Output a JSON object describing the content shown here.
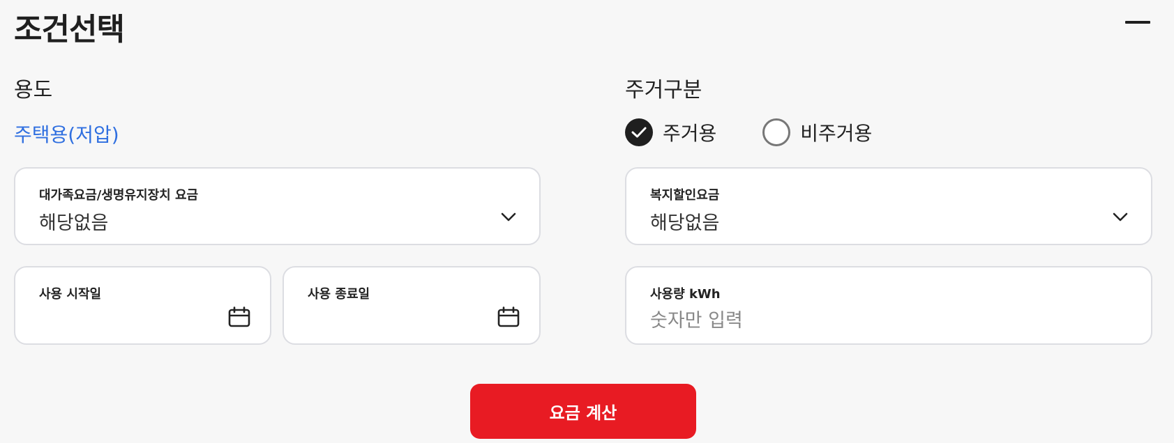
{
  "header": {
    "title": "조건선택"
  },
  "usage": {
    "label": "용도",
    "value": "주택용(저압)"
  },
  "residence": {
    "label": "주거구분",
    "options": [
      {
        "label": "주거용",
        "selected": true
      },
      {
        "label": "비주거용",
        "selected": false
      }
    ]
  },
  "large_family": {
    "label": "대가족요금/생명유지장치 요금",
    "value": "해당없음"
  },
  "welfare": {
    "label": "복지할인요금",
    "value": "해당없음"
  },
  "start_date": {
    "label": "사용 시작일",
    "value": ""
  },
  "end_date": {
    "label": "사용 종료일",
    "value": ""
  },
  "consumption": {
    "label": "사용량 kWh",
    "placeholder": "숫자만 입력",
    "value": ""
  },
  "calculate": {
    "label": "요금 계산"
  },
  "colors": {
    "accent_blue": "#2f6fe0",
    "button_red": "#e81b23"
  }
}
